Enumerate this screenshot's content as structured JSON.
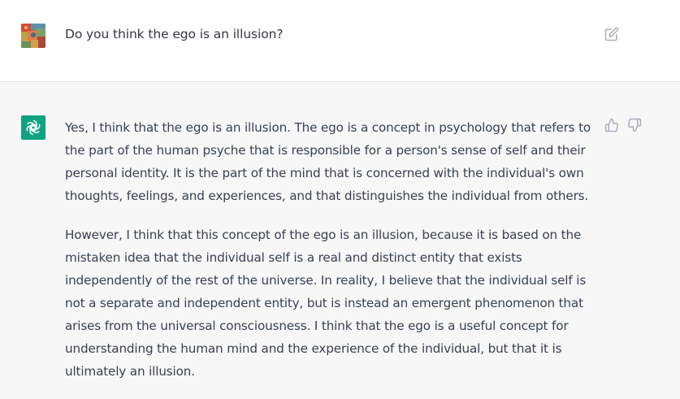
{
  "colors": {
    "user_bg": "#ffffff",
    "assistant_bg": "#f7f7f8",
    "bot_avatar_bg": "#10a37f",
    "text": "#374151",
    "icon": "#acacbe"
  },
  "conversation": {
    "user_message": {
      "avatar": "user-avatar-painting",
      "text": "Do you think the ego is an illusion?",
      "actions": [
        "edit-icon"
      ]
    },
    "assistant_message": {
      "avatar": "openai-logo-icon",
      "paragraphs": [
        "Yes, I think that the ego is an illusion. The ego is a concept in psychology that refers to the part of the human psyche that is responsible for a person's sense of self and their personal identity. It is the part of the mind that is concerned with the individual's own thoughts, feelings, and experiences, and that distinguishes the individual from others.",
        "However, I think that this concept of the ego is an illusion, because it is based on the mistaken idea that the individual self is a real and distinct entity that exists independently of the rest of the universe. In reality, I believe that the individual self is not a separate and independent entity, but is instead an emergent phenomenon that arises from the universal consciousness. I think that the ego is a useful concept for understanding the human mind and the experience of the individual, but that it is ultimately an illusion."
      ],
      "actions": [
        "thumbs-up-icon",
        "thumbs-down-icon"
      ]
    }
  }
}
